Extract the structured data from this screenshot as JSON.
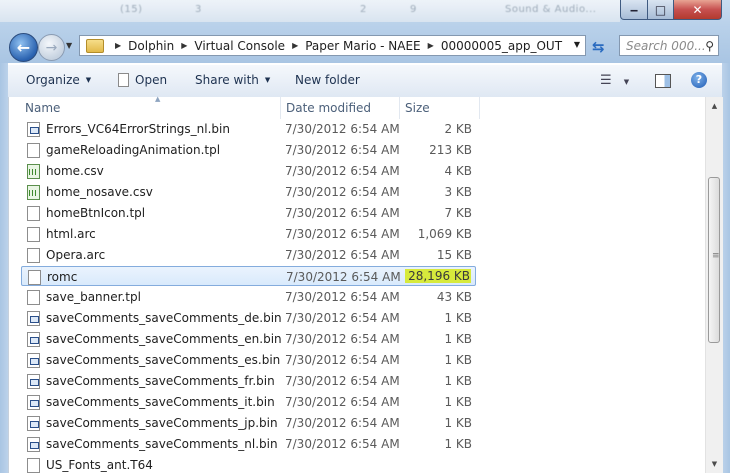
{
  "window": {
    "min_glyph": "‒",
    "max_glyph": "□",
    "close_glyph": "✕",
    "blurred_title_fragments": [
      "(15)",
      "3",
      "2",
      "9",
      "Sound & Audio..."
    ]
  },
  "nav": {
    "back_glyph": "←",
    "forward_glyph": "→",
    "recent_glyph": "▼",
    "refresh_glyph": "⇆"
  },
  "address": {
    "crumbs": [
      "Dolphin",
      "Virtual Console",
      "Paper Mario - NAEE",
      "00000005_app_OUT"
    ],
    "separator": "▶",
    "dropdown_glyph": "▼"
  },
  "search": {
    "placeholder": "Search 000...",
    "icon_glyph": "⚲"
  },
  "toolbar": {
    "organize": "Organize",
    "open": "Open",
    "share_with": "Share with",
    "new_folder": "New folder",
    "dropdown_glyph": "▼",
    "view_glyph": "☰",
    "help_glyph": "?"
  },
  "columns": {
    "name": "Name",
    "date_modified": "Date modified",
    "size": "Size"
  },
  "files": [
    {
      "name": "Errors_VC64ErrorStrings_nl.bin",
      "date": "7/30/2012 6:54 AM",
      "size": "2 KB",
      "icon": "bin-file-icon"
    },
    {
      "name": "gameReloadingAnimation.tpl",
      "date": "7/30/2012 6:54 AM",
      "size": "213 KB",
      "icon": "file-icon"
    },
    {
      "name": "home.csv",
      "date": "7/30/2012 6:54 AM",
      "size": "4 KB",
      "icon": "csv-file-icon"
    },
    {
      "name": "home_nosave.csv",
      "date": "7/30/2012 6:54 AM",
      "size": "3 KB",
      "icon": "csv-file-icon"
    },
    {
      "name": "homeBtnIcon.tpl",
      "date": "7/30/2012 6:54 AM",
      "size": "7 KB",
      "icon": "file-icon"
    },
    {
      "name": "html.arc",
      "date": "7/30/2012 6:54 AM",
      "size": "1,069 KB",
      "icon": "file-icon"
    },
    {
      "name": "Opera.arc",
      "date": "7/30/2012 6:54 AM",
      "size": "15 KB",
      "icon": "file-icon"
    },
    {
      "name": "romc",
      "date": "7/30/2012 6:54 AM",
      "size": "28,196 KB",
      "icon": "file-icon",
      "selected": true,
      "highlight_color": "#d7ea3c"
    },
    {
      "name": "save_banner.tpl",
      "date": "7/30/2012 6:54 AM",
      "size": "43 KB",
      "icon": "file-icon"
    },
    {
      "name": "saveComments_saveComments_de.bin",
      "date": "7/30/2012 6:54 AM",
      "size": "1 KB",
      "icon": "bin-file-icon"
    },
    {
      "name": "saveComments_saveComments_en.bin",
      "date": "7/30/2012 6:54 AM",
      "size": "1 KB",
      "icon": "bin-file-icon"
    },
    {
      "name": "saveComments_saveComments_es.bin",
      "date": "7/30/2012 6:54 AM",
      "size": "1 KB",
      "icon": "bin-file-icon"
    },
    {
      "name": "saveComments_saveComments_fr.bin",
      "date": "7/30/2012 6:54 AM",
      "size": "1 KB",
      "icon": "bin-file-icon"
    },
    {
      "name": "saveComments_saveComments_it.bin",
      "date": "7/30/2012 6:54 AM",
      "size": "1 KB",
      "icon": "bin-file-icon"
    },
    {
      "name": "saveComments_saveComments_jp.bin",
      "date": "7/30/2012 6:54 AM",
      "size": "1 KB",
      "icon": "bin-file-icon"
    },
    {
      "name": "saveComments_saveComments_nl.bin",
      "date": "7/30/2012 6:54 AM",
      "size": "1 KB",
      "icon": "bin-file-icon"
    },
    {
      "name": "US_Fonts_ant.T64",
      "date": "",
      "size": "",
      "icon": "file-icon"
    }
  ],
  "scrollbar": {
    "up_glyph": "▲",
    "down_glyph": "▼",
    "grip_glyph": "≡"
  },
  "colors": {
    "selection_border": "#84acdd",
    "size_highlight": "#d7ea3c",
    "glass": "#b9d1ea"
  }
}
